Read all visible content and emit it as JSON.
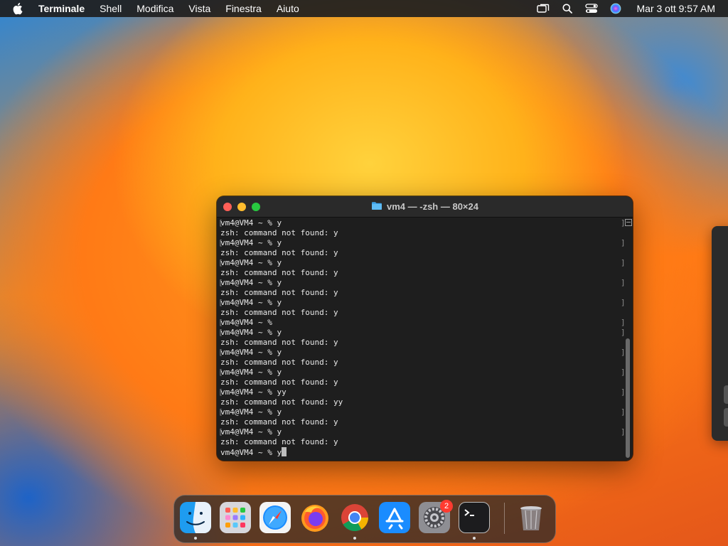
{
  "menubar": {
    "app_name": "Terminale",
    "menus": [
      "Shell",
      "Modifica",
      "Vista",
      "Finestra",
      "Aiuto"
    ],
    "clock": "Mar 3 ott  9:57 AM",
    "status_icons": [
      "screen-mirroring-icon",
      "search-icon",
      "control-center-icon",
      "siri-icon"
    ]
  },
  "window": {
    "title": "vm4 — -zsh — 80×24",
    "lines": [
      {
        "text": "vm4@VM4 ~ % y",
        "bracket": true
      },
      {
        "text": "zsh: command not found: y",
        "bracket": false
      },
      {
        "text": "vm4@VM4 ~ % y",
        "bracket": true
      },
      {
        "text": "zsh: command not found: y",
        "bracket": false
      },
      {
        "text": "vm4@VM4 ~ % y",
        "bracket": true
      },
      {
        "text": "zsh: command not found: y",
        "bracket": false
      },
      {
        "text": "vm4@VM4 ~ % y",
        "bracket": true
      },
      {
        "text": "zsh: command not found: y",
        "bracket": false
      },
      {
        "text": "vm4@VM4 ~ % y",
        "bracket": true
      },
      {
        "text": "zsh: command not found: y",
        "bracket": false
      },
      {
        "text": "vm4@VM4 ~ %",
        "bracket": true
      },
      {
        "text": "vm4@VM4 ~ % y",
        "bracket": true
      },
      {
        "text": "zsh: command not found: y",
        "bracket": false
      },
      {
        "text": "vm4@VM4 ~ % y",
        "bracket": true
      },
      {
        "text": "zsh: command not found: y",
        "bracket": false
      },
      {
        "text": "vm4@VM4 ~ % y",
        "bracket": true
      },
      {
        "text": "zsh: command not found: y",
        "bracket": false
      },
      {
        "text": "vm4@VM4 ~ % yy",
        "bracket": true
      },
      {
        "text": "zsh: command not found: yy",
        "bracket": false
      },
      {
        "text": "vm4@VM4 ~ % y",
        "bracket": true
      },
      {
        "text": "zsh: command not found: y",
        "bracket": false
      },
      {
        "text": "vm4@VM4 ~ % y",
        "bracket": true
      },
      {
        "text": "zsh: command not found: y",
        "bracket": false
      }
    ],
    "prompt_line": "vm4@VM4 ~ % y"
  },
  "dock": {
    "apps": [
      {
        "name": "Finder",
        "icon": "finder-icon",
        "running": true
      },
      {
        "name": "Launchpad",
        "icon": "launchpad-icon",
        "running": false
      },
      {
        "name": "Safari",
        "icon": "safari-icon",
        "running": false
      },
      {
        "name": "Firefox",
        "icon": "firefox-icon",
        "running": false
      },
      {
        "name": "Chrome",
        "icon": "chrome-icon",
        "running": true
      },
      {
        "name": "App Store",
        "icon": "app-store-icon",
        "running": false
      },
      {
        "name": "System Settings",
        "icon": "system-settings-icon",
        "running": false
      },
      {
        "name": "Terminal",
        "icon": "terminal-icon",
        "running": true
      }
    ],
    "settings_badge": "2",
    "trash": {
      "name": "Trash",
      "icon": "trash-icon"
    }
  }
}
